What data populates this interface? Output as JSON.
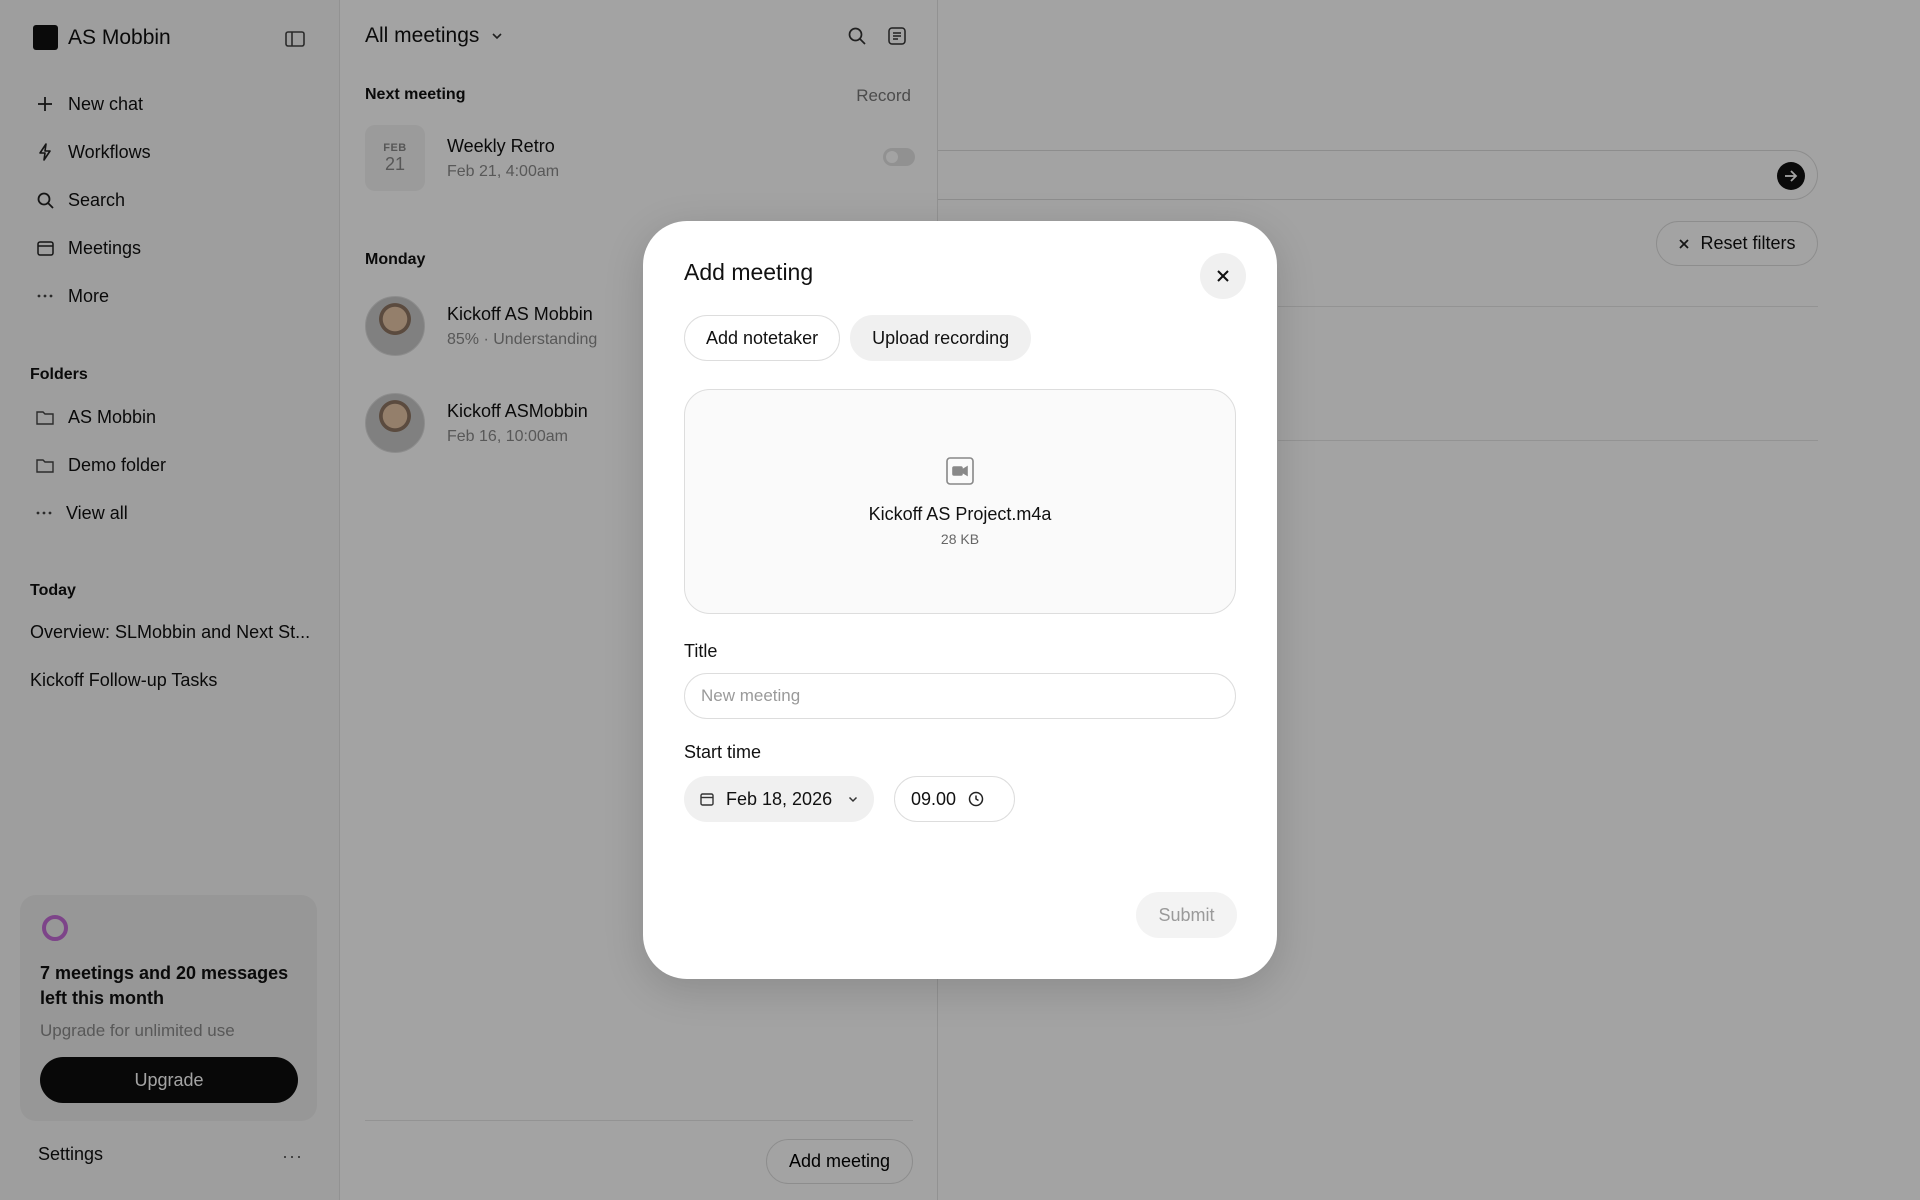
{
  "sidebar": {
    "brand": "AS Mobbin",
    "nav": [
      {
        "label": "New chat",
        "icon": "plus-icon"
      },
      {
        "label": "Workflows",
        "icon": "bolt-icon"
      },
      {
        "label": "Search",
        "icon": "search-icon"
      },
      {
        "label": "Meetings",
        "icon": "calendar-icon"
      },
      {
        "label": "More",
        "icon": "ellipsis-icon"
      }
    ],
    "folders_title": "Folders",
    "folders": [
      {
        "label": "AS Mobbin",
        "icon": "folder-icon"
      },
      {
        "label": "Demo folder",
        "icon": "folder-icon"
      },
      {
        "label": "View all",
        "icon": "ellipsis-icon"
      }
    ],
    "today_title": "Today",
    "today": [
      "Overview: SLMobbin and Next St...",
      "Kickoff Follow-up Tasks"
    ],
    "usage": {
      "title": "7 meetings and 20 messages left this month",
      "subtitle": "Upgrade for unlimited use",
      "button": "Upgrade"
    },
    "settings": "Settings",
    "settings_more": "···"
  },
  "meetings_panel": {
    "filter": "All meetings",
    "next_label": "Next meeting",
    "record": "Record",
    "next_meeting": {
      "month": "FEB",
      "day": "21",
      "title": "Weekly Retro",
      "time": "Feb 21, 4:00am"
    },
    "day_label": "Monday",
    "meetings": [
      {
        "title": "Kickoff AS Mobbin",
        "sub": "85%  ·  Understanding"
      },
      {
        "title": "Kickoff ASMobbin",
        "sub": "Feb 16, 10:00am"
      }
    ],
    "add_button": "Add meeting"
  },
  "main": {
    "reset_filters": "Reset filters"
  },
  "modal": {
    "title": "Add meeting",
    "tabs": [
      "Add notetaker",
      "Upload recording"
    ],
    "active_tab": "Upload recording",
    "file": {
      "name": "Kickoff AS Project.m4a",
      "size": "28 KB"
    },
    "title_label": "Title",
    "title_placeholder": "New meeting",
    "title_value": "",
    "start_label": "Start time",
    "date": "Feb 18, 2026",
    "time": "09.00",
    "submit": "Submit"
  },
  "colors": {
    "overlay": "#00000060",
    "primary_button": "#0e0e0e",
    "usage_ring": "#c46bd6"
  }
}
